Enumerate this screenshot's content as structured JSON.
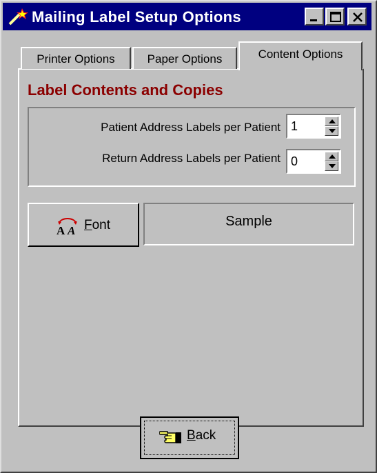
{
  "window": {
    "title": "Mailing Label Setup Options",
    "app_icon": "wand-icon",
    "controls": [
      "minimize-icon",
      "maximize-icon",
      "close-icon"
    ]
  },
  "tabs": [
    {
      "label": "Printer Options",
      "active": false
    },
    {
      "label": "Paper Options",
      "active": false
    },
    {
      "label": "Content Options",
      "active": true
    }
  ],
  "content": {
    "section_title": "Label Contents and Copies",
    "rows": [
      {
        "label": "Patient Address Labels per Patient",
        "value": "1"
      },
      {
        "label": "Return Address Labels per Patient",
        "value": "0"
      }
    ],
    "font_button": {
      "label_accel": "F",
      "label_rest": "ont",
      "icon": "font-aa-icon"
    },
    "sample_text": "Sample"
  },
  "footer": {
    "back_button": {
      "label_accel": "B",
      "label_rest": "ack",
      "icon": "pointing-hand-icon"
    }
  },
  "colors": {
    "titlebar": "#000080",
    "section_title": "#8b0000",
    "face": "#c0c0c0"
  }
}
